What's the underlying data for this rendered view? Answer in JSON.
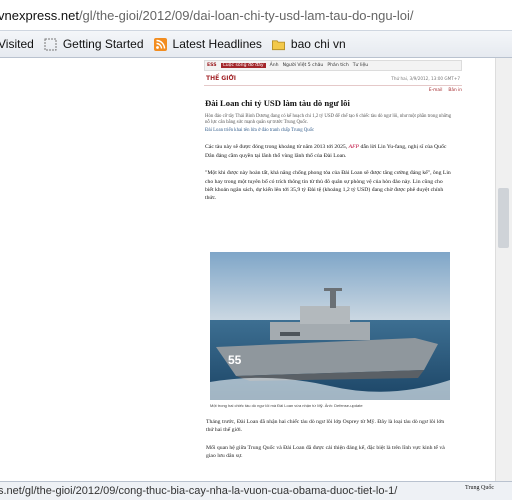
{
  "addressbar": {
    "domain": "vnexpress.net",
    "path": "/gl/the-gioi/2012/09/dai-loan-chi-ty-usd-lam-tau-do-ngu-loi/"
  },
  "bookmarks": [
    {
      "label": "Visited",
      "icon": "none"
    },
    {
      "label": "Getting Started",
      "icon": "page-icon"
    },
    {
      "label": "Latest Headlines",
      "icon": "rss-icon"
    },
    {
      "label": "bao chi vn",
      "icon": "folder-icon"
    }
  ],
  "site": {
    "logo": "ESS",
    "nav": [
      "Cuộc sống đó đây",
      "Ảnh",
      "Người Việt 5 châu",
      "Phân tích",
      "Tư liệu"
    ],
    "section": "THẾ GIỚI",
    "date": "Thứ hai, 3/9/2012, 13:00 GMT+7",
    "tools": [
      "E-mail",
      "Bản in"
    ]
  },
  "article": {
    "title": "Đài Loan chi tỷ USD làm tàu dò ngư lôi",
    "lead": "Hòn đảo cỡ tây Thái Bình Dương đang có kế hoạch chi 1,2 tỷ USD để chế tạo 6 chiếc tàu dò ngư lôi, như một phần trong những nỗ lực cân bằng sức mạnh quân sự trước Trung Quốc.",
    "related": "Đài Loan triển khai tên lửa ở đảo tranh chấp Trung Quốc",
    "p1_a": "Các tàu này sẽ được đóng trong khoảng từ năm 2013 tới 2025, ",
    "p1_b": "AFP",
    "p1_c": " dẫn lời Lin Yu-fang, nghị sĩ của Quốc Dân đảng cầm quyền tại lãnh thổ vùng lãnh thổ của Đài Loan.",
    "p2": "\"Một khi được này hoàn tất, khả năng chống phong tỏa của Đài Loan sẽ được tăng cường đáng kể\", ông Lin cho hay trong một tuyên bố có trích thông tin từ thủ đô quân sự phòng vệ của hòn đảo này. Lin cũng cho biết khoản ngân sách, dự kiến lên tới 35,9 tỷ Đài tệ (khoảng 1,2 tỷ USD) đang chờ được phê duyệt chính thức.",
    "photo_caption": "Một trong hai chiếc tàu dò ngư lôi mà Đài Loan vừa nhận từ Mỹ. Ảnh: Defense-update",
    "ship_number": "55",
    "p3": "Tháng trước, Đài Loan đã nhận hai chiếc tàu dò ngư lôi lớp Osprey từ Mỹ. Đây là loại tàu dò ngư lôi lớn thứ hai thế giới.",
    "p4": "Mối quan hệ giữa Trung Quốc và Đài Loan đã được cải thiện đáng kể, đặc biệt là trên lĩnh vực kinh tế và giao lưu dân sự."
  },
  "status": {
    "url": "s.net/gl/the-gioi/2012/09/cong-thuc-bia-cay-nha-la-vuon-cua-obama-duoc-tiet-lo-1/",
    "right_text": "Trung Quốc"
  }
}
